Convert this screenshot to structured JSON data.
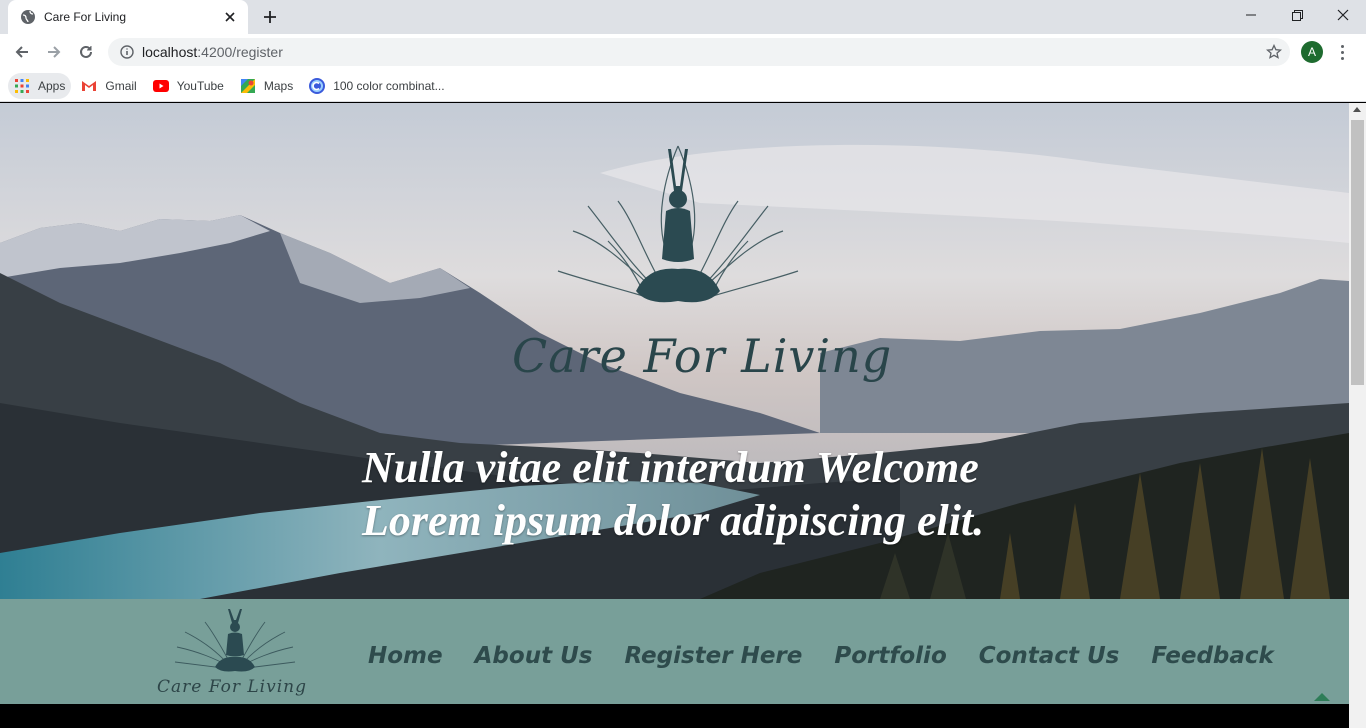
{
  "browser": {
    "tab_title": "Care For Living",
    "url_host": "localhost",
    "url_path": ":4200/register",
    "profile_initial": "A",
    "bookmarks": [
      {
        "label": "Apps",
        "icon": "apps-grid-icon"
      },
      {
        "label": "Gmail",
        "icon": "gmail-icon"
      },
      {
        "label": "YouTube",
        "icon": "youtube-icon"
      },
      {
        "label": "Maps",
        "icon": "maps-icon"
      },
      {
        "label": "100 color combinat...",
        "icon": "color-site-icon"
      }
    ]
  },
  "hero": {
    "brand": "Care For Living",
    "headline_line1": "Nulla vitae elit interdum Welcome",
    "headline_line2": "Lorem ipsum dolor adipiscing elit."
  },
  "navbar": {
    "brand": "Care For Living",
    "links": [
      "Home",
      "About Us",
      "Register Here",
      "Portfolio",
      "Contact Us",
      "Feedback"
    ]
  },
  "colors": {
    "navbar_bg": "#789f99",
    "nav_text": "#2e4b4c",
    "logo_color": "#29454a",
    "headline": "#ffffff"
  }
}
